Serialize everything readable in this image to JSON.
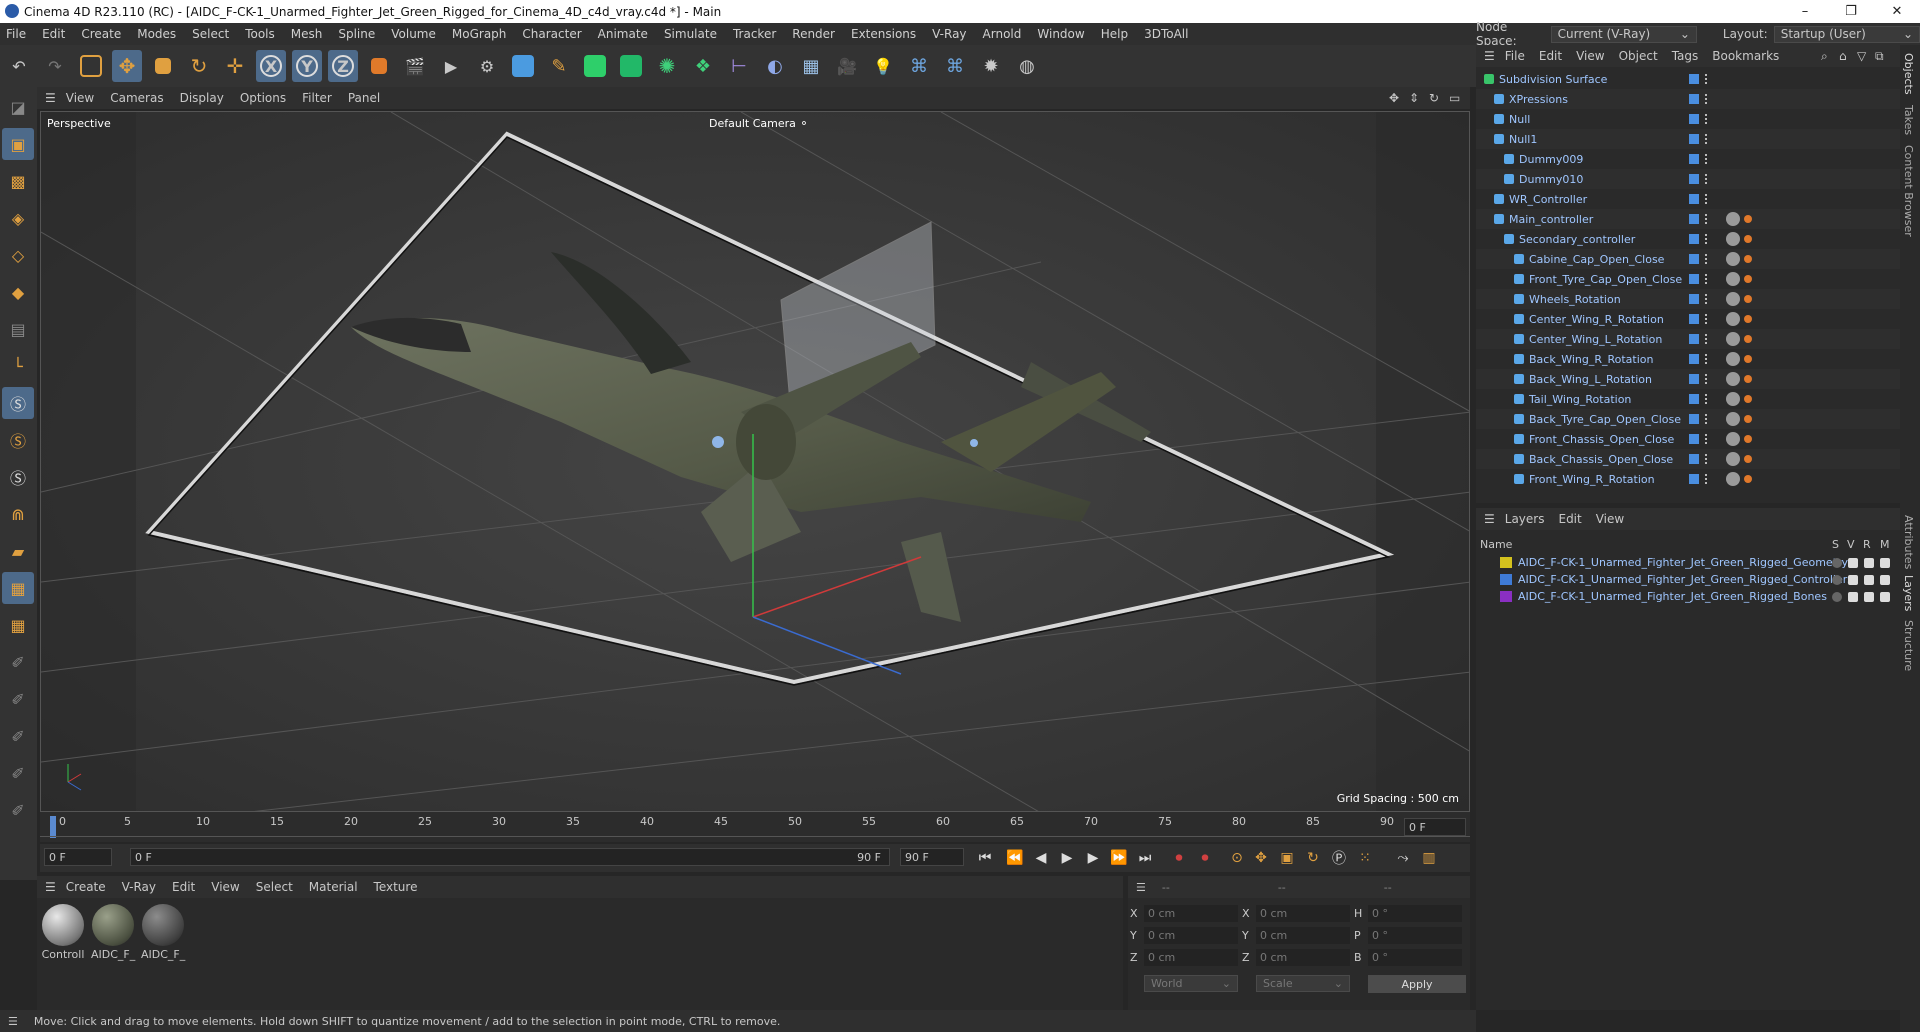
{
  "window": {
    "title": "Cinema 4D R23.110 (RC) - [AIDC_F-CK-1_Unarmed_Fighter_Jet_Green_Rigged_for_Cinema_4D_c4d_vray.c4d *] - Main",
    "minimize": "–",
    "maximize": "❐",
    "close": "✕"
  },
  "menu": [
    "File",
    "Edit",
    "Create",
    "Modes",
    "Select",
    "Tools",
    "Mesh",
    "Spline",
    "Volume",
    "MoGraph",
    "Character",
    "Animate",
    "Simulate",
    "Tracker",
    "Render",
    "Extensions",
    "V-Ray",
    "Arnold",
    "Window",
    "Help",
    "3DToAll"
  ],
  "nodespace": {
    "label": "Node Space:",
    "value": "Current (V-Ray)",
    "layout_label": "Layout:",
    "layout_value": "Startup (User)"
  },
  "viewport": {
    "menu": [
      "View",
      "Cameras",
      "Display",
      "Options",
      "Filter",
      "Panel"
    ],
    "label": "Perspective",
    "camera": "Default Camera",
    "grid": "Grid Spacing : 500 cm"
  },
  "timeline": {
    "ticks": [
      "0",
      "5",
      "10",
      "15",
      "20",
      "25",
      "30",
      "35",
      "40",
      "45",
      "50",
      "55",
      "60",
      "65",
      "70",
      "75",
      "80",
      "85",
      "90"
    ],
    "start": "0 F",
    "current": "0 F",
    "end_inner": "90 F",
    "end": "90 F",
    "right": "0 F"
  },
  "material": {
    "menu": [
      "Create",
      "V-Ray",
      "Edit",
      "View",
      "Select",
      "Material",
      "Texture"
    ],
    "items": [
      "Controll",
      "AIDC_F_",
      "AIDC_F_"
    ]
  },
  "coords": {
    "head": [
      "--",
      "--",
      "--"
    ],
    "rows": [
      [
        "X",
        "0 cm",
        "X",
        "0 cm",
        "H",
        "0 °"
      ],
      [
        "Y",
        "0 cm",
        "Y",
        "0 cm",
        "P",
        "0 °"
      ],
      [
        "Z",
        "0 cm",
        "Z",
        "0 cm",
        "B",
        "0 °"
      ]
    ],
    "world": "World",
    "scale": "Scale",
    "apply": "Apply"
  },
  "status": "Move: Click and drag to move elements. Hold down SHIFT to quantize movement / add to the selection in point mode, CTRL to remove.",
  "objects": {
    "menu": [
      "File",
      "Edit",
      "View",
      "Object",
      "Tags",
      "Bookmarks"
    ],
    "rows": [
      {
        "name": "Subdivision Surface",
        "level": 0
      },
      {
        "name": "XPressions",
        "level": 1
      },
      {
        "name": "Null",
        "level": 1
      },
      {
        "name": "Null1",
        "level": 1
      },
      {
        "name": "Dummy009",
        "level": 2
      },
      {
        "name": "Dummy010",
        "level": 2
      },
      {
        "name": "WR_Controller",
        "level": 1
      },
      {
        "name": "Main_controller",
        "level": 1
      },
      {
        "name": "Secondary_controller",
        "level": 2
      },
      {
        "name": "Cabine_Cap_Open_Close",
        "level": 3
      },
      {
        "name": "Front_Tyre_Cap_Open_Close",
        "level": 3
      },
      {
        "name": "Wheels_Rotation",
        "level": 3
      },
      {
        "name": "Center_Wing_R_Rotation",
        "level": 3
      },
      {
        "name": "Center_Wing_L_Rotation",
        "level": 3
      },
      {
        "name": "Back_Wing_R_Rotation",
        "level": 3
      },
      {
        "name": "Back_Wing_L_Rotation",
        "level": 3
      },
      {
        "name": "Tail_Wing_Rotation",
        "level": 3
      },
      {
        "name": "Back_Tyre_Cap_Open_Close",
        "level": 3
      },
      {
        "name": "Front_Chassis_Open_Close",
        "level": 3
      },
      {
        "name": "Back_Chassis_Open_Close",
        "level": 3
      },
      {
        "name": "Front_Wing_R_Rotation",
        "level": 3
      }
    ]
  },
  "layers": {
    "menu": [
      "Layers",
      "Edit",
      "View"
    ],
    "header": {
      "name": "Name",
      "s": "S",
      "v": "V",
      "r": "R",
      "m": "M"
    },
    "rows": [
      {
        "name": "AIDC_F-CK-1_Unarmed_Fighter_Jet_Green_Rigged_Geometry",
        "color": "#d4c21e"
      },
      {
        "name": "AIDC_F-CK-1_Unarmed_Fighter_Jet_Green_Rigged_Controllers",
        "color": "#3f7bd6"
      },
      {
        "name": "AIDC_F-CK-1_Unarmed_Fighter_Jet_Green_Rigged_Bones",
        "color": "#8a2fc2"
      }
    ]
  },
  "side_tabs": [
    "Objects",
    "Takes",
    "Content Browser",
    "Attributes",
    "Layers",
    "Structure"
  ]
}
